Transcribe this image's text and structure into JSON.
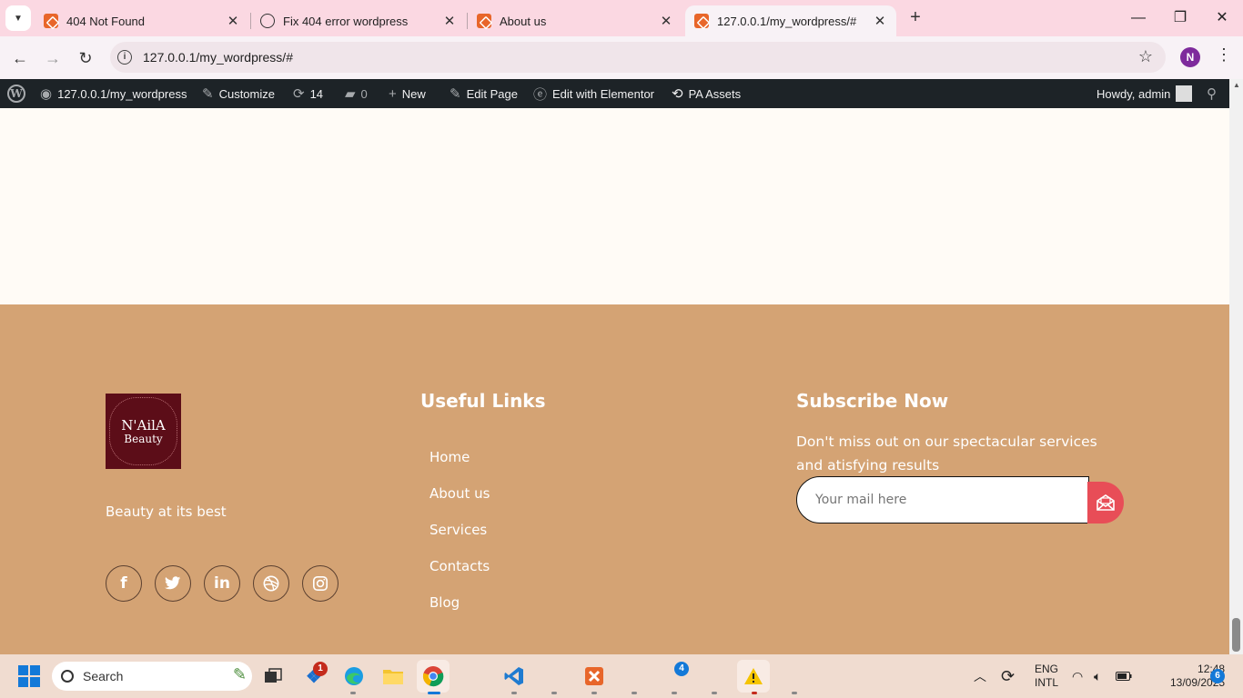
{
  "browser": {
    "tabs": [
      {
        "title": "404 Not Found",
        "active": false
      },
      {
        "title": "Fix 404 error wordpress",
        "active": false
      },
      {
        "title": "About us",
        "active": false
      },
      {
        "title": "127.0.0.1/my_wordpress/#",
        "active": true
      }
    ],
    "url": "127.0.0.1/my_wordpress/#",
    "profile_initial": "N"
  },
  "admin_bar": {
    "site": "127.0.0.1/my_wordpress",
    "customize": "Customize",
    "updates_count": "14",
    "comments_count": "0",
    "new": "New",
    "edit_page": "Edit Page",
    "edit_elementor": "Edit with Elementor",
    "pa_assets": "PA Assets",
    "howdy": "Howdy, admin"
  },
  "footer": {
    "logo": {
      "line1": "N'AilA",
      "line2": "Beauty"
    },
    "tagline": "Beauty at its best",
    "socials": [
      "facebook",
      "twitter",
      "linkedin",
      "dribbble",
      "instagram"
    ],
    "useful_links": {
      "title": "Useful Links",
      "items": [
        "Home",
        "About us",
        "Services",
        "Contacts",
        "Blog"
      ]
    },
    "subscribe": {
      "title": "Subscribe Now",
      "text": "Don't miss out on our spectacular services and atisfying results",
      "placeholder": "Your mail here"
    }
  },
  "taskbar": {
    "search_label": "Search",
    "badges": {
      "edge_notif": "1",
      "app_count": "4",
      "notifications": "6"
    },
    "language": {
      "line1": "ENG",
      "line2": "INTL"
    },
    "time": "12:48",
    "date": "13/09/2025"
  },
  "colors": {
    "footer_bg": "#d4a374",
    "logo_bg": "#5c0d18",
    "subscribe_button": "#e84d57",
    "tab_strip": "#fbd8e2"
  }
}
